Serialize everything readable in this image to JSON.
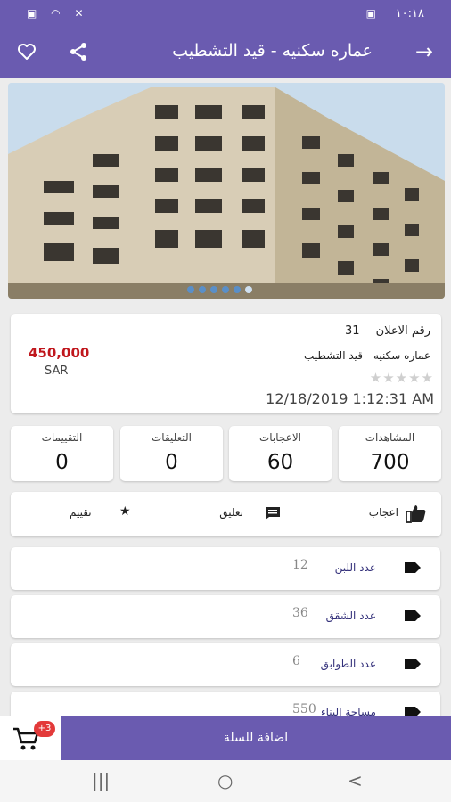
{
  "status_bar": {
    "time": "١٠:١٨",
    "left_icons": [
      "sim-icon",
      "wifi-icon",
      "mute-icon"
    ],
    "right_icon": "gallery-icon"
  },
  "app_bar": {
    "title": "عماره سكنيه - قيد التشطيب",
    "back_icon": "arrow-right-icon",
    "share_icon": "share-icon",
    "favorite_icon": "heart-icon",
    "color": "#6a5bb0"
  },
  "gallery": {
    "slide_count": 6,
    "active_index": 5
  },
  "listing": {
    "ad_number_label": "رقم الاعلان",
    "ad_number": "31",
    "title": "عماره سكنيه - قيد التشطيب",
    "rating_stars": 0,
    "rating_max": 5,
    "date": "12/18/2019 1:12:31 AM",
    "price": "450,000",
    "currency": "SAR",
    "price_color": "#c0171d"
  },
  "stats": [
    {
      "label": "المشاهدات",
      "value": "700"
    },
    {
      "label": "الاعجابات",
      "value": "60"
    },
    {
      "label": "التعليقات",
      "value": "0"
    },
    {
      "label": "التقييمات",
      "value": "0"
    }
  ],
  "actions": {
    "like_label": "اعجاب",
    "comment_label": "تعليق",
    "rate_label": "تقييم"
  },
  "features": [
    {
      "label": "عدد اللبن",
      "value": "12"
    },
    {
      "label": "عدد الشقق",
      "value": "36"
    },
    {
      "label": "عدد الطوابق",
      "value": "6"
    },
    {
      "label": "مساحة البناء",
      "value": "550"
    }
  ],
  "cart": {
    "badge": "+3",
    "add_button_label": "اضافة للسلة"
  },
  "nav_bar": {
    "recent": "|||",
    "home": "○",
    "back": "<"
  }
}
